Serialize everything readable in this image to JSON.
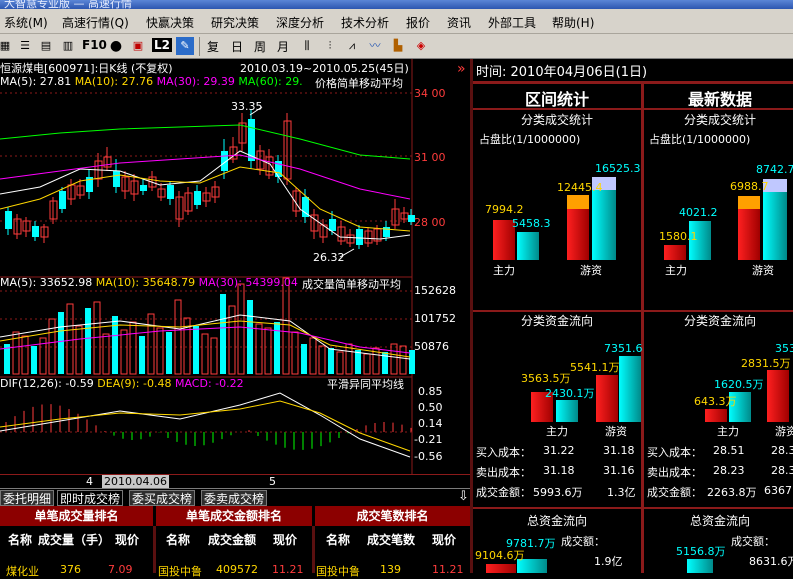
{
  "window": {
    "title": "大智慧专业版 — 高速行情"
  },
  "menu": [
    "系统(M)",
    "高速行情(Q)",
    "快赢决策",
    "研究决策",
    "深度分析",
    "技术分析",
    "报价",
    "资讯",
    "外部工具",
    "帮助(H)"
  ],
  "toolbar": {
    "f10": "F10",
    "l2": "L2",
    "period_buttons": [
      "复",
      "日",
      "周",
      "月"
    ]
  },
  "chart": {
    "header": "恒源煤电[600971]:日K线 (不复权)",
    "range": "2010.03.19~2010.05.25(45日)",
    "ma_line": {
      "ma5": "MA(5): 27.81",
      "ma10": "MA(10): 27.76",
      "ma30": "MA(30): 29.39",
      "ma60": "MA(60): 29.",
      "label": "价格简单移动平均"
    },
    "price_ticks": [
      "34 00",
      "31 00",
      "28 00"
    ],
    "high_label": "33.35",
    "low_label": "26.32",
    "vol_line": {
      "ma5": "MA(5): 33652.98",
      "ma10": "MA(10): 35648.79",
      "ma30": "MA(30): 54399.04",
      "label": "成交量简单移动平均"
    },
    "vol_ticks": [
      "152628",
      "101752",
      "50876"
    ],
    "macd_line": {
      "dif": "DIF(12,26): -0.59",
      "dea": "DEA(9): -0.48",
      "macd": "MACD: -0.22",
      "label": "平滑异同平均线"
    },
    "macd_ticks": [
      "0.85",
      "0.50",
      "0.14",
      "-0.21",
      "-0.56"
    ],
    "xaxis": {
      "m4": "4",
      "sel_date": "2010.04.06",
      "m5": "5"
    },
    "colors": {
      "up": "#ff3c3c",
      "down": "#00ffff",
      "ma5": "#ffffff",
      "ma10": "#ffd700",
      "ma30": "#ff00ff",
      "ma60": "#00ff00"
    }
  },
  "tabs": [
    "委托明细",
    "即时成交榜",
    "委买成交榜",
    "委卖成交榜"
  ],
  "ranking": {
    "headers": [
      "单笔成交量排名",
      "单笔成交金额排名",
      "成交笔数排名"
    ],
    "cols": [
      [
        "名称",
        "成交量（手）",
        "现价"
      ],
      [
        "名称",
        "成交金额",
        "现价"
      ],
      [
        "名称",
        "成交笔数",
        "现价"
      ]
    ],
    "row": [
      [
        "煤化业",
        "376",
        "7.09"
      ],
      [
        "国投中鲁",
        "409572",
        "11.21"
      ],
      [
        "国投中鲁",
        "139",
        "11.21"
      ]
    ]
  },
  "right": {
    "time": "时间: 2010年04月06日(1日)",
    "left_panel": "区间统计",
    "right_panel": "最新数据",
    "stat1": "分类成交统计",
    "ratio": "占盘比(1/1000000)",
    "left_bars": {
      "a": "7994.2",
      "b": "5458.3",
      "c": "12445.4",
      "d": "16525.3",
      "l1": "主力",
      "l2": "游资"
    },
    "right_bars": {
      "a": "1580.1",
      "b": "4021.2",
      "c": "6988.7",
      "d": "8742.7",
      "l1": "主力",
      "l2": "游资"
    },
    "stat2": "分类资金流向",
    "left_flow": {
      "a": "3563.5万",
      "b": "2430.1万",
      "c": "5541.1万",
      "d": "7351.6",
      "l1": "主力",
      "l2": "游资"
    },
    "right_flow": {
      "a": "643.3万",
      "b": "1620.5万",
      "c": "2831.5万",
      "d": "353",
      "l1": "主力",
      "l2": "游资"
    },
    "left_table": [
      [
        "买入成本：",
        "31.22",
        "31.18"
      ],
      [
        "卖出成本：",
        "31.18",
        "31.16"
      ],
      [
        "成交金额：",
        "5993.6万",
        "1.3亿"
      ]
    ],
    "right_table": [
      [
        "买入成本：",
        "28.51",
        "28.3"
      ],
      [
        "卖出成本：",
        "28.23",
        "28.3"
      ],
      [
        "成交金额：",
        "2263.8万",
        "6367."
      ]
    ],
    "stat3": "总资金流向",
    "left_total": {
      "a": "9104.6万",
      "b": "9781.7万",
      "label": "成交额：",
      "value": "1.9亿"
    },
    "right_total": {
      "a": "5156.8万",
      "label": "成交额：",
      "value": "8631.6万"
    }
  }
}
